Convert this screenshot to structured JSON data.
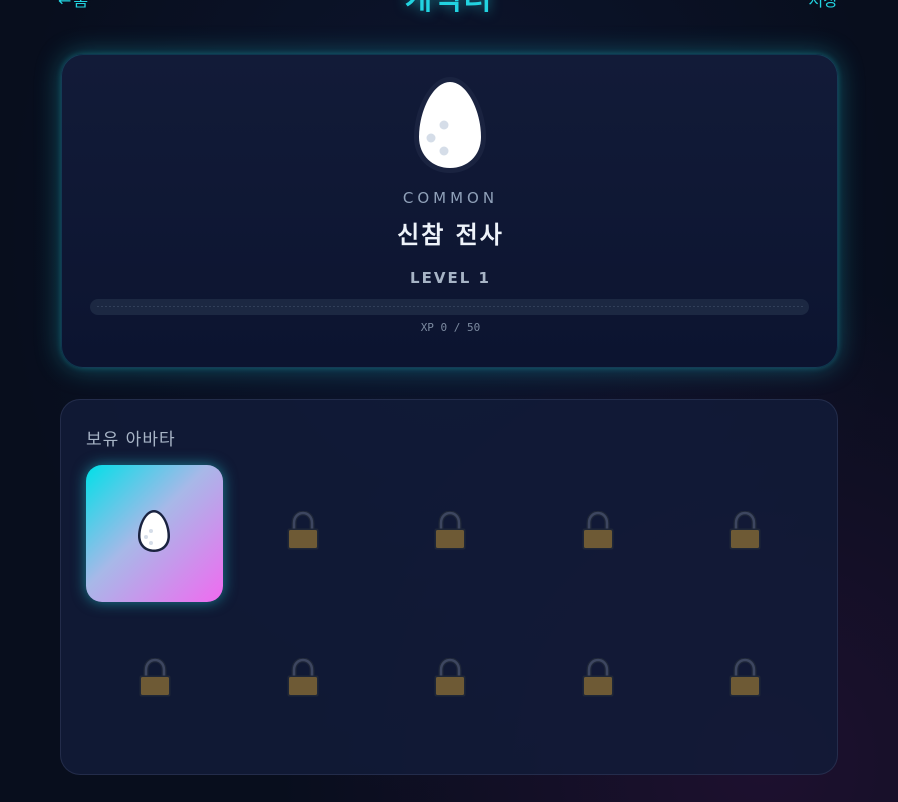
{
  "header": {
    "back_arrow": "←",
    "back_label": "홈",
    "title": "캐릭터",
    "save_label": "저장"
  },
  "profile": {
    "rarity": "COMMON",
    "name": "신참 전사",
    "level_label": "LEVEL 1",
    "xp_text": "XP 0 / 50",
    "xp_current": 0,
    "xp_max": 50,
    "avatar_icon": "egg-icon"
  },
  "inventory": {
    "title": "보유 아바타",
    "slots": [
      {
        "state": "selected",
        "icon": "egg-icon"
      },
      {
        "state": "locked",
        "icon": "lock-icon"
      },
      {
        "state": "locked",
        "icon": "lock-icon"
      },
      {
        "state": "locked",
        "icon": "lock-icon"
      },
      {
        "state": "locked",
        "icon": "lock-icon"
      },
      {
        "state": "locked",
        "icon": "lock-icon"
      },
      {
        "state": "locked",
        "icon": "lock-icon"
      },
      {
        "state": "locked",
        "icon": "lock-icon"
      },
      {
        "state": "locked",
        "icon": "lock-icon"
      },
      {
        "state": "locked",
        "icon": "lock-icon"
      }
    ]
  },
  "colors": {
    "accent": "#22d3e0",
    "accent_secondary": "#e770f0",
    "background": "#080e1d",
    "card": "#121b38",
    "lock": "#6e5a35"
  }
}
